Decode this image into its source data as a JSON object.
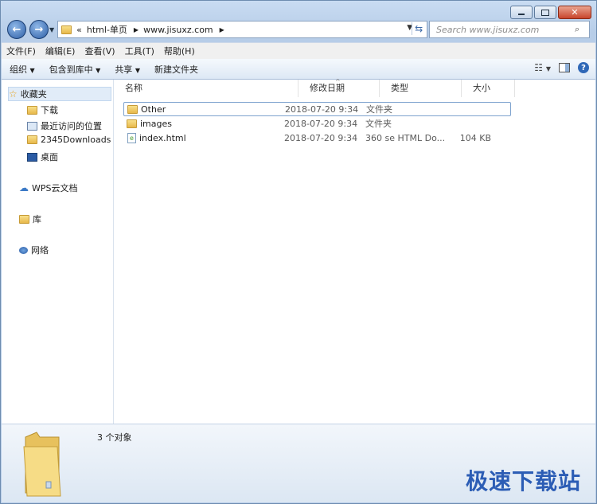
{
  "address": {
    "chevron": "«",
    "crumbs": [
      "html-单页",
      "www.jisuxz.com"
    ]
  },
  "search": {
    "placeholder": "Search www.jisuxz.com"
  },
  "menu": [
    "文件(F)",
    "编辑(E)",
    "查看(V)",
    "工具(T)",
    "帮助(H)"
  ],
  "toolbar": {
    "organize": "组织",
    "include": "包含到库中",
    "share": "共享",
    "new_folder": "新建文件夹"
  },
  "sidebar": {
    "favorites": "收藏夹",
    "items": [
      "下载",
      "最近访问的位置",
      "2345Downloads",
      "桌面"
    ],
    "wps": "WPS云文档",
    "library": "库",
    "network": "网络"
  },
  "columns": {
    "name": "名称",
    "date": "修改日期",
    "type": "类型",
    "size": "大小"
  },
  "files": [
    {
      "name": "Other",
      "date": "2018-07-20 9:34",
      "type": "文件夹",
      "size": ""
    },
    {
      "name": "images",
      "date": "2018-07-20 9:34",
      "type": "文件夹",
      "size": ""
    },
    {
      "name": "index.html",
      "date": "2018-07-20 9:34",
      "type": "360 se HTML Do...",
      "size": "104 KB"
    }
  ],
  "status": {
    "count": "3 个对象"
  },
  "watermark": "极速下载站",
  "colors": {
    "accent": "#2c5db5",
    "folder": "#e7b84a",
    "selection": "#7da2ce"
  }
}
